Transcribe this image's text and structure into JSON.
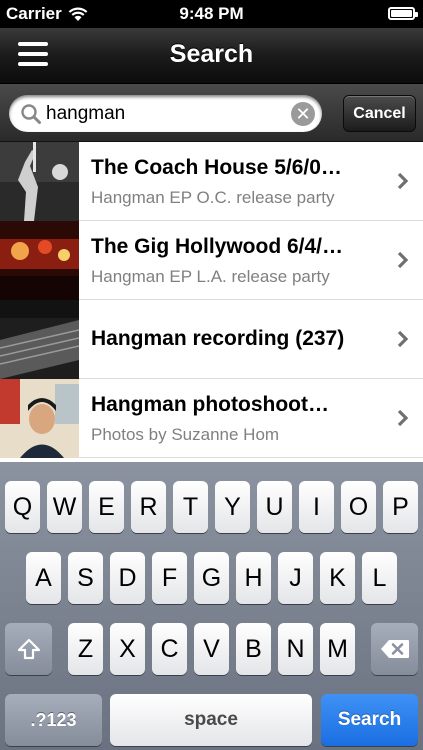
{
  "status_bar": {
    "carrier": "Carrier",
    "time": "9:48 PM"
  },
  "nav": {
    "title": "Search",
    "menu_icon": "hamburger-menu-icon"
  },
  "search": {
    "value": "hangman",
    "cancel_label": "Cancel"
  },
  "results": [
    {
      "title": "The Coach House 5/6/0…",
      "subtitle": "Hangman EP O.C. release party",
      "thumb": "band-performance-photo"
    },
    {
      "title": "The Gig Hollywood 6/4/…",
      "subtitle": "Hangman EP L.A. release party",
      "thumb": "concert-stage-photo"
    },
    {
      "title": "Hangman recording (237)",
      "subtitle": "",
      "thumb": "recording-studio-photo"
    },
    {
      "title": "Hangman photoshoot…",
      "subtitle": "Photos by Suzanne Hom",
      "thumb": "portrait-photo"
    }
  ],
  "keyboard": {
    "row1": [
      "Q",
      "W",
      "E",
      "R",
      "T",
      "Y",
      "U",
      "I",
      "O",
      "P"
    ],
    "row2": [
      "A",
      "S",
      "D",
      "F",
      "G",
      "H",
      "J",
      "K",
      "L"
    ],
    "row3": [
      "Z",
      "X",
      "C",
      "V",
      "B",
      "N",
      "M"
    ],
    "numbers_label": ".?123",
    "space_label": "space",
    "search_label": "Search"
  },
  "colors": {
    "search_key": "#1a6fe2",
    "nav_bar": "#1b1b1b"
  }
}
